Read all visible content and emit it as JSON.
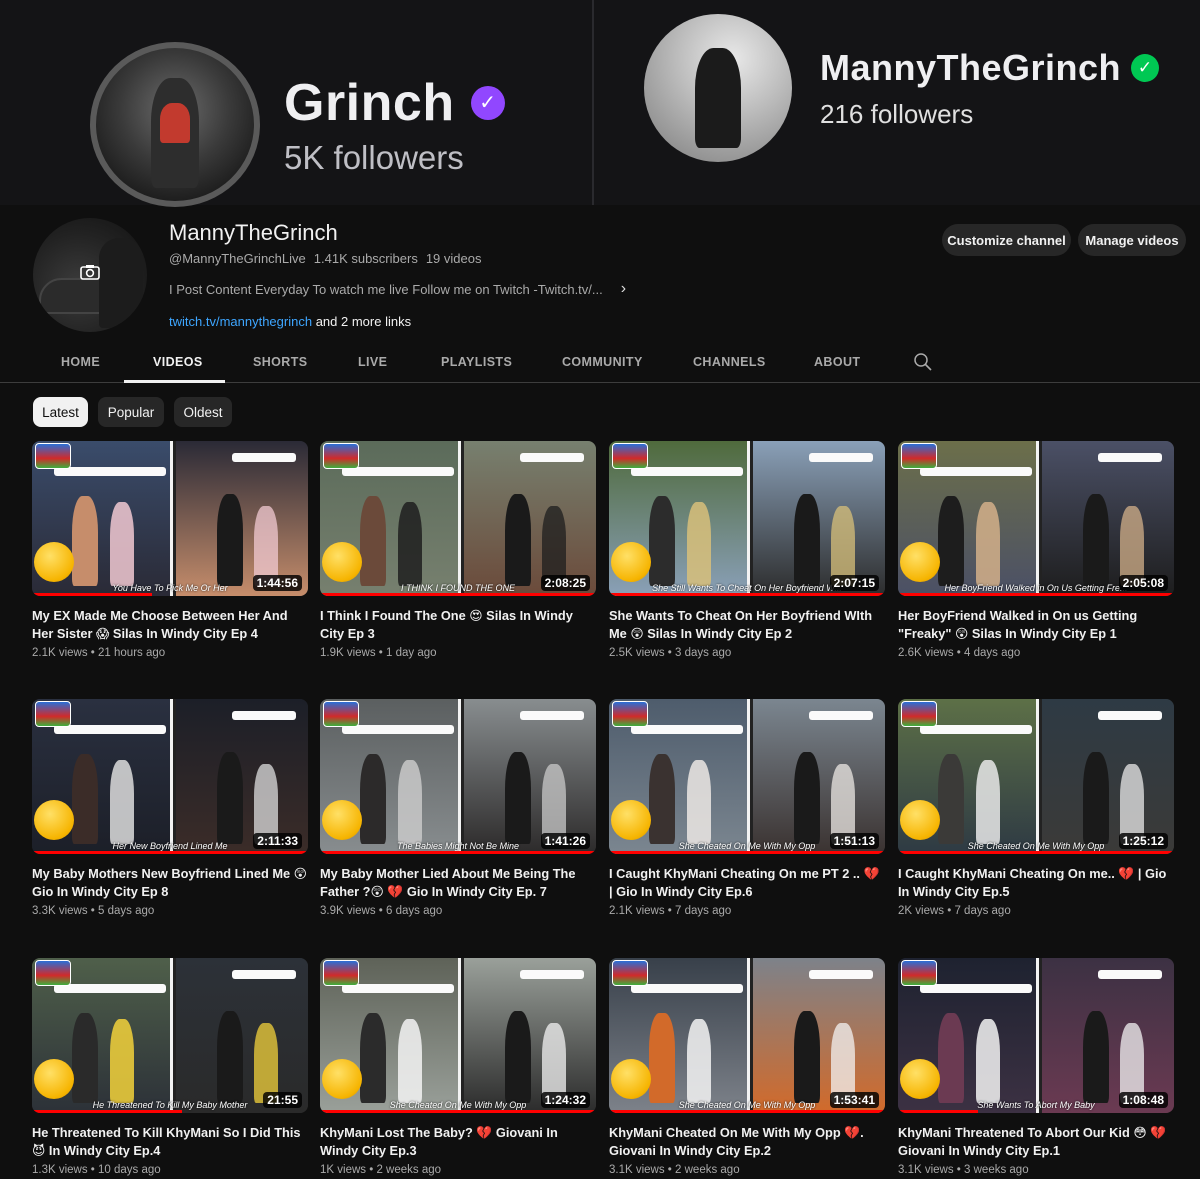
{
  "banner": {
    "left": {
      "name": "Grinch",
      "followers": "5K followers",
      "verified_color": "#9147ff"
    },
    "right": {
      "name": "MannyTheGrinch",
      "followers": "216 followers",
      "verified_color": "#00c853"
    }
  },
  "channel": {
    "name": "MannyTheGrinch",
    "handle": "@MannyTheGrinchLive",
    "subscribers": "1.41K subscribers",
    "video_count": "19 videos",
    "description": "I Post Content Everyday To watch me live Follow me on Twitch -Twitch.tv/...",
    "link_primary": "twitch.tv/mannythegrinch",
    "link_more": " and 2 more links",
    "customize_label": "Customize channel",
    "manage_label": "Manage videos"
  },
  "tabs": [
    "HOME",
    "VIDEOS",
    "SHORTS",
    "LIVE",
    "PLAYLISTS",
    "COMMUNITY",
    "CHANNELS",
    "ABOUT"
  ],
  "active_tab": "VIDEOS",
  "chips": [
    "Latest",
    "Popular",
    "Oldest"
  ],
  "active_chip": "Latest",
  "videos": [
    {
      "title": "My EX Made Me Choose Between Her And Her Sister 😱 Silas In Windy City Ep 4",
      "views": "2.1K views",
      "age": "21 hours ago",
      "duration": "1:44:56",
      "caption": "You Have To Pick Me Or Her"
    },
    {
      "title": "I Think I Found The One 😍 Silas In Windy City Ep 3",
      "views": "1.9K views",
      "age": "1 day ago",
      "duration": "2:08:25",
      "caption": "I THINK I FOUND THE ONE"
    },
    {
      "title": "She Wants To Cheat On Her Boyfriend WIth Me 😲 Silas In Windy City Ep 2",
      "views": "2.5K views",
      "age": "3 days ago",
      "duration": "2:07:15",
      "caption": "She Still Wants To Cheat On Her Boyfriend W..."
    },
    {
      "title": "Her BoyFriend Walked in On us Getting \"Freaky\" 😲 Silas In Windy City Ep 1",
      "views": "2.6K views",
      "age": "4 days ago",
      "duration": "2:05:08",
      "caption": "Her BoyFriend Walked in On Us Getting Fre..."
    },
    {
      "title": "My Baby Mothers New Boyfriend Lined Me 😲 Gio In Windy City Ep 8",
      "views": "3.3K views",
      "age": "5 days ago",
      "duration": "2:11:33",
      "caption": "Her New Boyfriend Lined Me"
    },
    {
      "title": "My Baby Mother Lied About Me Being The Father ?😲 💔 Gio In Windy City Ep. 7",
      "views": "3.9K views",
      "age": "6 days ago",
      "duration": "1:41:26",
      "caption": "The Babies Might Not Be Mine"
    },
    {
      "title": "I Caught KhyMani Cheating On me PT 2 .. 💔 | Gio In Windy City Ep.6",
      "views": "2.1K views",
      "age": "7 days ago",
      "duration": "1:51:13",
      "caption": "She Cheated On Me With My Opp"
    },
    {
      "title": "I Caught KhyMani Cheating On me.. 💔 | Gio In Windy City Ep.5",
      "views": "2K views",
      "age": "7 days ago",
      "duration": "1:25:12",
      "caption": "She Cheated On Me With My Opp"
    },
    {
      "title": "He Threatened To Kill KhyMani So I Did This 😈 In Windy City Ep.4",
      "views": "1.3K views",
      "age": "10 days ago",
      "duration": "21:55",
      "caption": "He Threatened To Kill My Baby Mother"
    },
    {
      "title": "KhyMani Lost The Baby? 💔 Giovani In Windy City Ep.3",
      "views": "1K views",
      "age": "2 weeks ago",
      "duration": "1:24:32",
      "caption": "She Cheated On Me With My Opp"
    },
    {
      "title": "KhyMani Cheated On Me With My Opp 💔. Giovani In Windy City Ep.2",
      "views": "3.1K views",
      "age": "2 weeks ago",
      "duration": "1:53:41",
      "caption": "She Cheated On Me With My Opp"
    },
    {
      "title": "KhyMani Threatened To Abort Our Kid 😳 💔 Giovani In Windy City Ep.1",
      "views": "3.1K views",
      "age": "3 weeks ago",
      "duration": "1:08:48",
      "caption": "She Wants To Abort My Baby"
    }
  ],
  "colors": {
    "background": "#0f0f0f",
    "link": "#3ea6ff",
    "progress": "#ff0000",
    "twitch_purple": "#9147ff",
    "verified_green": "#00c853"
  },
  "icons": [
    "camera-icon",
    "chevron-right-icon",
    "search-icon",
    "verified-badge-icon"
  ]
}
